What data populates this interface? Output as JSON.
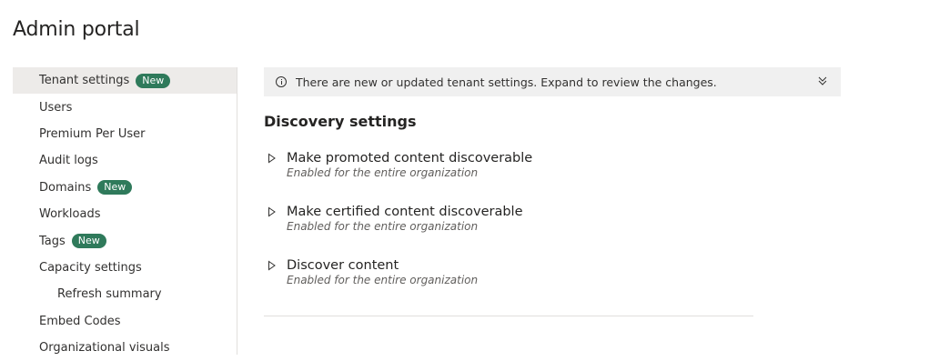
{
  "page": {
    "title": "Admin portal"
  },
  "sidebar": {
    "items": [
      {
        "label": "Tenant settings",
        "badge": "New"
      },
      {
        "label": "Users"
      },
      {
        "label": "Premium Per User"
      },
      {
        "label": "Audit logs"
      },
      {
        "label": "Domains",
        "badge": "New"
      },
      {
        "label": "Workloads"
      },
      {
        "label": "Tags",
        "badge": "New"
      },
      {
        "label": "Capacity settings"
      },
      {
        "label": "Refresh summary"
      },
      {
        "label": "Embed Codes"
      },
      {
        "label": "Organizational visuals"
      }
    ]
  },
  "banner": {
    "text": "There are new or updated tenant settings. Expand to review the changes.",
    "icon": "info-icon",
    "expand_icon": "chevron-double-down-icon"
  },
  "section": {
    "heading": "Discovery settings",
    "settings": [
      {
        "name": "Make promoted content discoverable",
        "description": "Enabled for the entire organization"
      },
      {
        "name": "Make certified content discoverable",
        "description": "Enabled for the entire organization"
      },
      {
        "name": "Discover content",
        "description": "Enabled for the entire organization"
      }
    ]
  },
  "colors": {
    "badge": "#2f7a5b",
    "selected_bg": "#edebe9",
    "banner_bg": "#f0f0f0"
  }
}
